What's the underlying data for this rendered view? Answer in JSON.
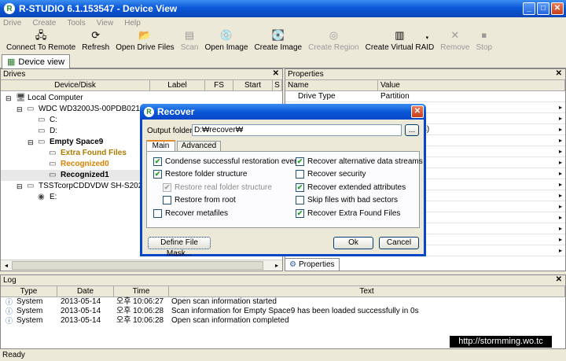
{
  "window": {
    "title": "R-STUDIO 6.1.153547 - Device View",
    "min": "_",
    "max": "□",
    "close": "✕"
  },
  "menu": [
    "Drive",
    "Create",
    "Tools",
    "View",
    "Help"
  ],
  "toolbar": [
    {
      "label": "Connect To Remote",
      "icon": "network-icon",
      "glyph": "🖧",
      "enabled": true
    },
    {
      "label": "Refresh",
      "icon": "refresh-icon",
      "glyph": "⟳",
      "enabled": true
    },
    {
      "label": "Open Drive Files",
      "icon": "folder-open-icon",
      "glyph": "📂",
      "enabled": true
    },
    {
      "label": "Scan",
      "icon": "scan-icon",
      "glyph": "▤",
      "enabled": false
    },
    {
      "label": "Open Image",
      "icon": "open-image-icon",
      "glyph": "💿",
      "enabled": true
    },
    {
      "label": "Create Image",
      "icon": "create-image-icon",
      "glyph": "💽",
      "enabled": true
    },
    {
      "label": "Create Region",
      "icon": "create-region-icon",
      "glyph": "◎",
      "enabled": false
    },
    {
      "label": "Create Virtual RAID",
      "icon": "raid-icon",
      "glyph": "▥",
      "enabled": true
    },
    {
      "label": "Remove",
      "icon": "remove-icon",
      "glyph": "✕",
      "enabled": false
    },
    {
      "label": "Stop",
      "icon": "stop-icon",
      "glyph": "⏹",
      "enabled": false
    }
  ],
  "doc_tab": "Device view",
  "drives_panel": {
    "title": "Drives",
    "close": "✕",
    "columns": [
      "Device/Disk",
      "Label",
      "FS",
      "Start",
      "S"
    ],
    "rows": [
      {
        "label": "Local Computer",
        "indent": 0,
        "bold": false,
        "color": "#000000",
        "icon": "computer-icon",
        "glyph": "🖥",
        "exp": "⊟"
      },
      {
        "label": "WDC WD3200JS-00PDB021.00M21",
        "indent": 1,
        "bold": false,
        "color": "#000000",
        "icon": "hard-disk-icon",
        "glyph": "▭",
        "exp": "⊟"
      },
      {
        "label": "C:",
        "indent": 2,
        "bold": false,
        "color": "#000000",
        "icon": "partition-icon",
        "glyph": "▭",
        "exp": ""
      },
      {
        "label": "D:",
        "indent": 2,
        "bold": false,
        "color": "#000000",
        "icon": "partition-icon",
        "glyph": "▭",
        "exp": ""
      },
      {
        "label": "Empty Space9",
        "indent": 2,
        "bold": true,
        "color": "#000000",
        "icon": "partition-icon",
        "glyph": "▭",
        "exp": "⊟"
      },
      {
        "label": "Extra Found Files",
        "indent": 3,
        "bold": true,
        "color": "#b07a00",
        "icon": "partition-icon",
        "glyph": "▭",
        "exp": ""
      },
      {
        "label": "Recognized0",
        "indent": 3,
        "bold": true,
        "color": "#d98200",
        "icon": "partition-icon",
        "glyph": "▭",
        "exp": ""
      },
      {
        "label": "Recognized1",
        "indent": 3,
        "bold": true,
        "color": "#000000",
        "icon": "partition-icon",
        "glyph": "▭",
        "exp": "",
        "selected": true
      },
      {
        "label": "TSSTcorpCDDVDW SH-S202NS",
        "indent": 1,
        "bold": false,
        "color": "#000000",
        "icon": "cd-drive-icon",
        "glyph": "▭",
        "exp": "⊟"
      },
      {
        "label": "E:",
        "indent": 2,
        "bold": false,
        "color": "#000000",
        "icon": "cd-icon",
        "glyph": "◉",
        "exp": ""
      }
    ]
  },
  "properties_panel": {
    "title": "Properties",
    "close": "✕",
    "columns": [
      "Name",
      "Value"
    ],
    "rows": [
      {
        "name": "Drive Type",
        "value": "Partition",
        "arrow": ""
      },
      {
        "name": "",
        "value": "",
        "arrow": "▸"
      },
      {
        "name": "",
        "value": "",
        "arrow": "▸"
      },
      {
        "name": "",
        "value": "4752 Sectors)",
        "arrow": "▸"
      },
      {
        "name": "",
        "value": "",
        "arrow": "▸"
      },
      {
        "name": "",
        "value": "",
        "arrow": "▸"
      },
      {
        "name": "",
        "value": "",
        "arrow": "▸"
      },
      {
        "name": "",
        "value": "",
        "arrow": "▸"
      },
      {
        "name": "",
        "value": "ectors)",
        "arrow": "▸"
      },
      {
        "name": "",
        "value": "",
        "arrow": "▸"
      },
      {
        "name": "",
        "value": "",
        "arrow": "▸"
      },
      {
        "name": "",
        "value": "ectors)",
        "arrow": "▸"
      },
      {
        "name": "",
        "value": "",
        "arrow": "▸"
      },
      {
        "name": "",
        "value": "ectors)",
        "arrow": "▸"
      },
      {
        "name": "",
        "value": "ectors)",
        "arrow": "▸"
      }
    ],
    "tab": "Properties"
  },
  "log": {
    "title": "Log",
    "close": "✕",
    "columns": [
      "Type",
      "Date",
      "Time",
      "Text"
    ],
    "rows": [
      {
        "type": "System",
        "date": "2013-05-14",
        "time": "오후 10:06:27",
        "text": "Open scan information started"
      },
      {
        "type": "System",
        "date": "2013-05-14",
        "time": "오후 10:06:28",
        "text": "Scan information for Empty Space9 has been loaded successfully in 0s"
      },
      {
        "type": "System",
        "date": "2013-05-14",
        "time": "오후 10:06:28",
        "text": "Open scan information completed"
      }
    ]
  },
  "status": "Ready",
  "watermark": "http://stormming.wo.tc",
  "dialog": {
    "title": "Recover",
    "close": "✕",
    "output_label": "Output folder:",
    "output_value": "D:₩recover₩",
    "browse": "...",
    "tabs": [
      "Main",
      "Advanced"
    ],
    "left_options": [
      {
        "label": "Condense successful restoration events",
        "checked": true,
        "disabled": false,
        "indent": 0
      },
      {
        "label": "Restore folder structure",
        "checked": true,
        "disabled": false,
        "indent": 0
      },
      {
        "label": "Restore real folder structure",
        "checked": true,
        "disabled": true,
        "indent": 1
      },
      {
        "label": "Restore from root",
        "checked": false,
        "disabled": false,
        "indent": 1
      },
      {
        "label": "Recover metafiles",
        "checked": false,
        "disabled": false,
        "indent": 0
      }
    ],
    "right_options": [
      {
        "label": "Recover alternative data streams",
        "checked": true,
        "disabled": false
      },
      {
        "label": "Recover security",
        "checked": false,
        "disabled": false
      },
      {
        "label": "Recover extended attributes",
        "checked": true,
        "disabled": false
      },
      {
        "label": "Skip files with bad sectors",
        "checked": false,
        "disabled": false
      },
      {
        "label": "Recover Extra Found Files",
        "checked": true,
        "disabled": false
      }
    ],
    "file_mask": "Define File Mask...",
    "ok": "Ok",
    "cancel": "Cancel"
  }
}
